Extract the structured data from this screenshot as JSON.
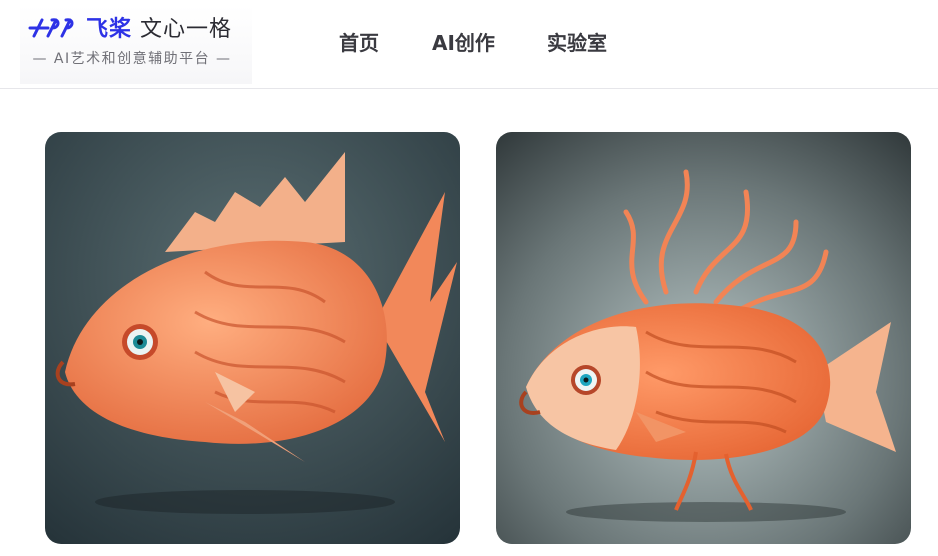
{
  "header": {
    "brand": "飞桨",
    "product": "文心一格",
    "tagline": "— AI艺术和创意辅助平台 —",
    "logo_icon": "paddlepaddle-logo-icon"
  },
  "nav": {
    "items": [
      {
        "label": "首页"
      },
      {
        "label": "AI创作"
      },
      {
        "label": "实验室"
      }
    ]
  },
  "gallery": {
    "images": [
      {
        "subject": "orange-noodle-fish-art-1"
      },
      {
        "subject": "orange-noodle-fish-art-2"
      }
    ]
  },
  "colors": {
    "brand_blue": "#2d32e6",
    "fish_orange": "#f58a57",
    "bg_teal": "#3b4a52"
  }
}
